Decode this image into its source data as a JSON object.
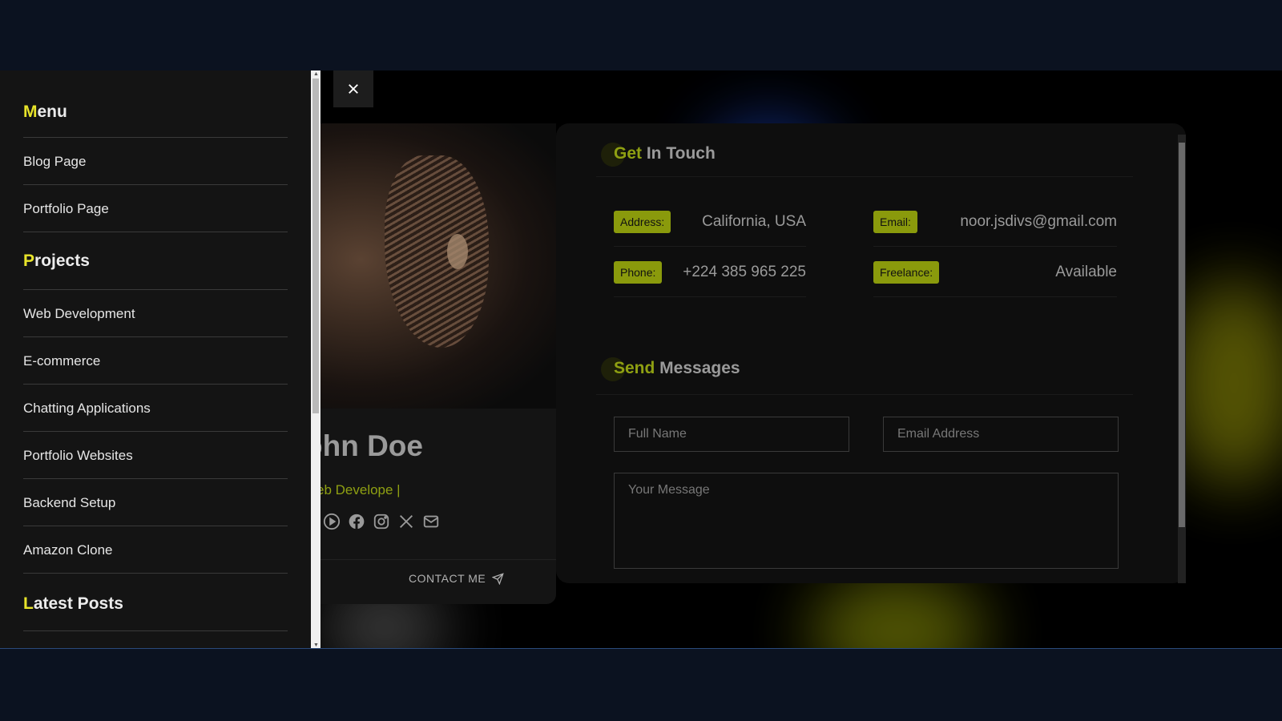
{
  "sidebar": {
    "menu_heading": {
      "accent": "M",
      "rest": "enu"
    },
    "menu_items": [
      "Blog Page",
      "Portfolio Page"
    ],
    "projects_heading": {
      "accent": "P",
      "rest": "rojects"
    },
    "project_items": [
      "Web Development",
      "E-commerce",
      "Chatting Applications",
      "Portfolio Websites",
      "Backend Setup",
      "Amazon Clone"
    ],
    "posts_heading": {
      "accent": "L",
      "rest": "atest Posts"
    }
  },
  "close_icon": "close-icon",
  "profile": {
    "name": "ohn Doe",
    "role": "eb Develope |",
    "socials": [
      "youtube-icon",
      "facebook-icon",
      "instagram-icon",
      "x-icon",
      "mail-icon"
    ],
    "contact_label": "CONTACT ME"
  },
  "get_in_touch": {
    "accent": "Get",
    "rest": " In Touch",
    "address_label": "Address:",
    "address_value": "California, USA",
    "email_label": "Email:",
    "email_value": "noor.jsdivs@gmail.com",
    "phone_label": "Phone:",
    "phone_value": "+224 385 965 225",
    "freelance_label": "Freelance:",
    "freelance_value": "Available"
  },
  "send_messages": {
    "accent": "Send",
    "rest": " Messages",
    "name_placeholder": "Full Name",
    "email_placeholder": "Email Address",
    "message_placeholder": "Your Message"
  },
  "colors": {
    "accent_yellow": "#e8e42a",
    "accent_olive": "#8fa012",
    "badge": "#8a9a0c"
  }
}
